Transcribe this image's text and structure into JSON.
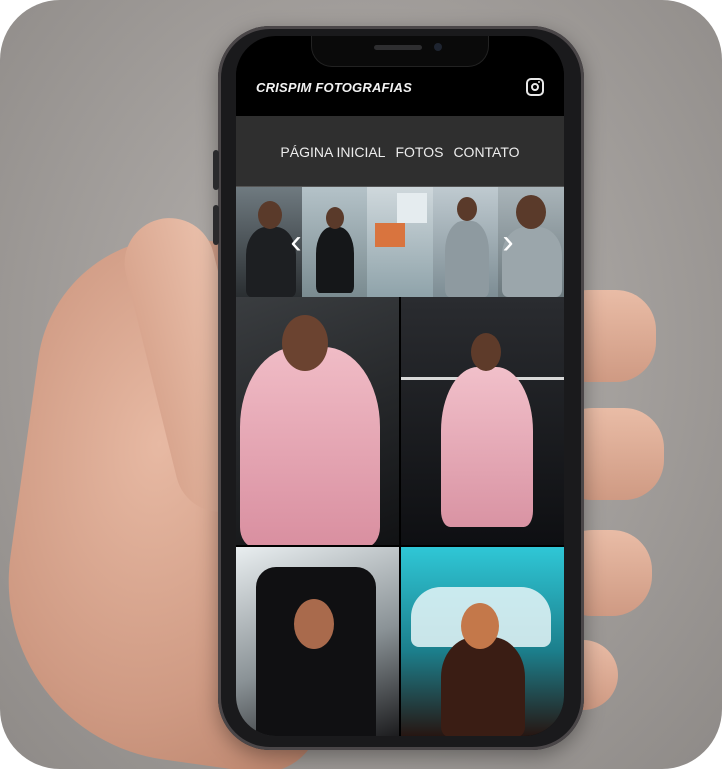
{
  "header": {
    "brand": "CRISPIM FOTOGRAFIAS",
    "social_icon": "instagram-icon"
  },
  "nav": {
    "items": [
      {
        "label": "PÁGINA INICIAL"
      },
      {
        "label": "FOTOS"
      },
      {
        "label": "CONTATO"
      }
    ]
  },
  "carousel": {
    "prev_icon": "chevron-left-icon",
    "next_icon": "chevron-right-icon",
    "prev_glyph": "‹",
    "next_glyph": "›"
  },
  "colors": {
    "topbar": "#000000",
    "navbar": "#2f2f2f",
    "nav_text": "#ededed"
  }
}
